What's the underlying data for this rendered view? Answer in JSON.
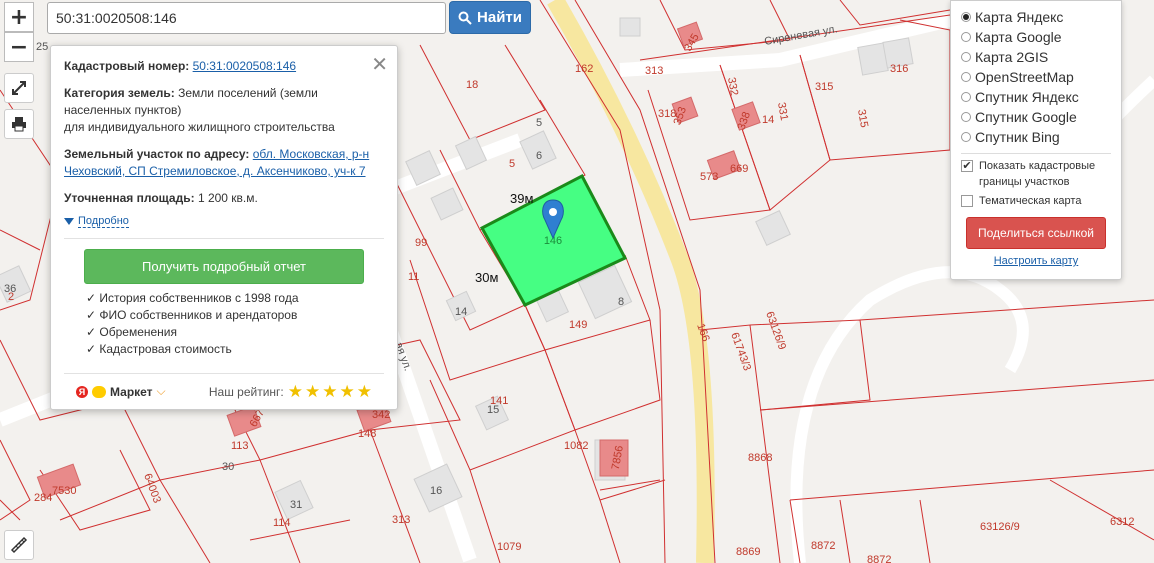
{
  "search": {
    "value": "50:31:0020508:146",
    "button_label": "Найти"
  },
  "zoom": {
    "in_label": "+",
    "out_label": "−"
  },
  "popup": {
    "cadastral_label": "Кадастровый номер:",
    "cadastral_value": "50:31:0020508:146",
    "category_label": "Категория земель:",
    "category_value": "Земли поселений (земли населенных пунктов)",
    "category_use": "для индивидуального жилищного строительства",
    "address_label": "Земельный участок по адресу:",
    "address_value": "обл. Московская, р-н Чеховский, СП Стремиловское, д. Аксенчиково, уч-к 7",
    "area_label": "Уточненная площадь:",
    "area_value": "1 200 кв.м.",
    "more_label": "Подробно",
    "report_button": "Получить подробный отчет",
    "features": [
      "История собственников с 1998 года",
      "ФИО собственников и арендаторов",
      "Обременения",
      "Кадастровая стоимость"
    ],
    "market_label": "Маркет",
    "rating_label": "Наш рейтинг:",
    "rating_stars": 5
  },
  "layers": {
    "options": [
      "Карта Яндекс",
      "Карта Google",
      "Карта 2GIS",
      "OpenStreetMap",
      "Спутник Яндекс",
      "Спутник Google",
      "Спутник Bing"
    ],
    "selected": 0,
    "show_borders_label": "Показать кадастровые границы участков",
    "show_borders_checked": true,
    "thematic_label": "Тематическая карта",
    "thematic_checked": false,
    "share_button": "Поделиться ссылкой",
    "settings_link": "Настроить карту"
  },
  "map": {
    "plot_number": "146",
    "dimension_top": "39м",
    "dimension_left": "30м",
    "street_1": "Сиреневая ул.",
    "street_2": "...ая ул.",
    "parcel_labels": [
      "162",
      "313",
      "316",
      "315",
      "315",
      "332",
      "331",
      "318",
      "353",
      "338",
      "14",
      "573",
      "669",
      "18",
      "5",
      "6",
      "5",
      "99",
      "11",
      "36",
      "2",
      "14",
      "8",
      "149",
      "166",
      "63126/9",
      "61743/3",
      "141",
      "15",
      "1082",
      "7856",
      "8868",
      "113",
      "667",
      "148",
      "342",
      "30",
      "64003",
      "284",
      "7530",
      "31",
      "114",
      "16",
      "313",
      "1079",
      "8869",
      "8872",
      "8872",
      "63126/9",
      "6312",
      "345",
      "25"
    ],
    "colors": {
      "selected_plot": "#33ff77",
      "selected_border": "#1a8a1a",
      "parcel_line": "#d03030",
      "road": "#f7e7a0",
      "pin": "#2f7fd1"
    }
  }
}
